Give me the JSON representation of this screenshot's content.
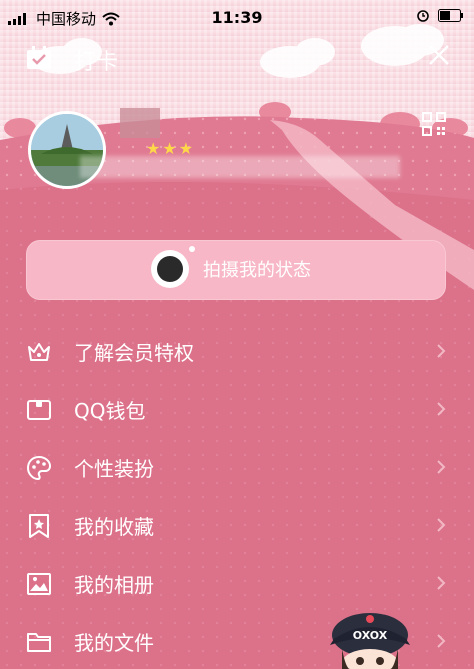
{
  "status_bar": {
    "carrier": "中国移动",
    "time": "11:39"
  },
  "header": {
    "title": "打卡"
  },
  "profile": {
    "star_count": 3
  },
  "photo_button": {
    "label": "拍摄我的状态"
  },
  "menu": [
    {
      "label": "了解会员特权",
      "icon": "crown-icon"
    },
    {
      "label": "QQ钱包",
      "icon": "wallet-icon"
    },
    {
      "label": "个性装扮",
      "icon": "palette-icon"
    },
    {
      "label": "我的收藏",
      "icon": "bookmark-star-icon"
    },
    {
      "label": "我的相册",
      "icon": "image-icon"
    },
    {
      "label": "我的文件",
      "icon": "folder-icon"
    }
  ],
  "mascot": {
    "cap_text": "OXOX"
  },
  "colors": {
    "background": "#d86a83",
    "button": "#f7b7c6",
    "stars": "#ffd84a"
  }
}
